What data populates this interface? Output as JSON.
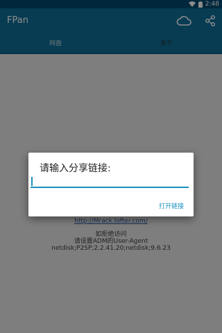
{
  "status_bar": {
    "time": "2:48"
  },
  "app_bar": {
    "title": "FPan",
    "actions": [
      {
        "icon": "cloud-icon"
      },
      {
        "icon": "share-icon"
      }
    ]
  },
  "tabs": [
    {
      "label": "网盘",
      "selected": false
    },
    {
      "label": "关于",
      "selected": true
    }
  ],
  "content": {
    "link": "http://Mrack.lofter.com/",
    "lines": [
      "如拒绝访问",
      "请设置ADM的User-Agent",
      "netdisk;P2SP;2.2.41.20;netdisk;9.6.23"
    ]
  },
  "dialog": {
    "title": "请输入分享链接:",
    "input_value": "",
    "button_label": "打开链接"
  },
  "colors": {
    "app_bar": "#0e6e98",
    "status_bar": "#004a6e",
    "accent": "#1a8fbe"
  }
}
